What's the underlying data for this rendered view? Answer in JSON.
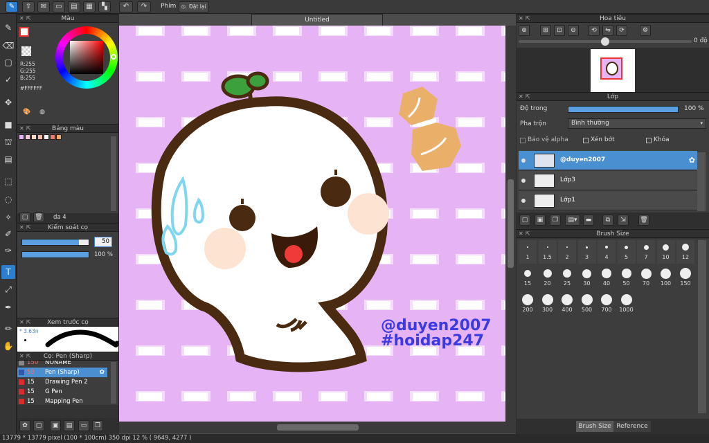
{
  "topbar": {
    "phim_label": "Phím",
    "reset_label": "Đặt lại",
    "icons": [
      "brush-mode-icon",
      "share-icon",
      "comment-icon",
      "browser-icon",
      "document-icon",
      "grid-icon",
      "layout-icon",
      "undo-icon",
      "redo-icon"
    ]
  },
  "canvas": {
    "title": "Untitled",
    "watermark_line1": "@duyen2007",
    "watermark_line2": "#hoidap247",
    "bg_color": "#e6b4f5"
  },
  "color_panel": {
    "title": "Màu",
    "r": "R:255",
    "g": "G:255",
    "b": "B:255",
    "hex": "#FFFFFF"
  },
  "palette_panel": {
    "title": "Bảng màu",
    "swatches": [
      "#e6b4f5",
      "#f4c8d8",
      "#f7d9c9",
      "#f8b9a8",
      "#ffffff",
      "#f07a6a",
      "#f3a66a"
    ],
    "footer_label": "da 4"
  },
  "brush_control": {
    "title": "Kiểm soát cọ",
    "size_value": "50",
    "opacity_value": "100 %",
    "size_fraction": 0.85,
    "opacity_fraction": 1.0
  },
  "preview_panel": {
    "title": "Xem trước cọ",
    "size_text": "* 3.63n"
  },
  "brush_list": {
    "title": "Cọ: Pen (Sharp)",
    "items": [
      {
        "size": "150",
        "name": "NONAME",
        "color": "#888888"
      },
      {
        "size": "50",
        "name": "Pen (Sharp)",
        "color": "#3355aa"
      },
      {
        "size": "15",
        "name": "Drawing Pen 2",
        "color": "#dd2a2a"
      },
      {
        "size": "15",
        "name": "G Pen",
        "color": "#dd2a2a"
      },
      {
        "size": "15",
        "name": "Mapping Pen",
        "color": "#dd2a2a"
      }
    ]
  },
  "navigator": {
    "title": "Hoa tiêu",
    "angle": "0 độ"
  },
  "layer_panel": {
    "title": "Lớp",
    "opacity_label": "Độ trong",
    "opacity_value": "100 %",
    "blend_label": "Pha trộn",
    "blend_value": "Bình thường",
    "alpha_protect": "Bảo vệ alpha",
    "clipping": "Xén bớt",
    "lock": "Khóa",
    "layers": [
      {
        "name": "@duyen2007",
        "selected": true
      },
      {
        "name": "Lớp3",
        "selected": false
      },
      {
        "name": "Lớp1",
        "selected": false
      }
    ]
  },
  "brush_size_panel": {
    "title": "Brush Size",
    "sizes": [
      "1",
      "1.5",
      "2",
      "3",
      "4",
      "5",
      "7",
      "10",
      "12",
      "15",
      "20",
      "25",
      "30",
      "40",
      "50",
      "70",
      "100",
      "150",
      "200",
      "300",
      "400",
      "500",
      "700",
      "1000"
    ],
    "tab_active": "Brush Size",
    "tab_other": "Reference"
  },
  "status": {
    "text": "13779 * 13779 pixel  (100 * 100cm)  350 dpi  12 %  ( 9649, 4277 )"
  }
}
